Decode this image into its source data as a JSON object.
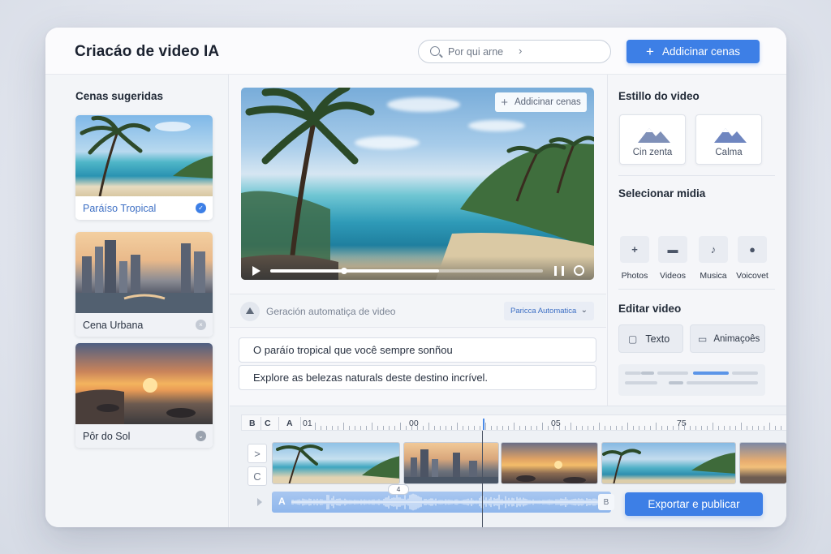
{
  "header": {
    "title": "Criacáo de video IA",
    "search_placeholder": "Por qui arne",
    "search_chevron": "›",
    "primary_button": "Addicinar cenas"
  },
  "sidebar": {
    "title": "Cenas sugeridas",
    "scenes": [
      {
        "label": "Paráíso Tropical",
        "selected": true,
        "status_icon": "check-circle-icon"
      },
      {
        "label": "Cena Urbana",
        "selected": false,
        "status_icon": "close-circle-icon"
      },
      {
        "label": "Pôr do Sol",
        "selected": false,
        "status_icon": "chevron-circle-icon"
      }
    ]
  },
  "preview": {
    "add_button": "Addicinar cenas",
    "progress": 0.62,
    "knob_position": 0.27
  },
  "autogen": {
    "label": "Geración automatiça de video",
    "dropdown": "Paricca Automatica",
    "chevron": "⌄"
  },
  "script_lines": [
    "O paráío tropical que você sempre sonñou",
    "Explore as belezas naturals deste destino incrível."
  ],
  "style_panel": {
    "title": "Estillo do video",
    "styles": [
      {
        "label": "Cin zenta"
      },
      {
        "label": "Calma"
      }
    ]
  },
  "media_panel": {
    "title": "Selecionar midia",
    "items": [
      {
        "label": "Photos",
        "icon": "photo-plus-icon",
        "glyph": "+"
      },
      {
        "label": "Videos",
        "icon": "video-icon",
        "glyph": "▬"
      },
      {
        "label": "Musica",
        "icon": "music-note-icon",
        "glyph": "♪"
      },
      {
        "label": "Voicovet",
        "icon": "microphone-icon",
        "glyph": "●"
      }
    ]
  },
  "edit_panel": {
    "title": "Editar video",
    "buttons": [
      {
        "label": "Texto",
        "glyph": "▢"
      },
      {
        "label": "Animaçoês",
        "glyph": "▭"
      }
    ]
  },
  "timeline": {
    "track_letters": [
      "B",
      "C",
      "A"
    ],
    "ruler_labels": [
      "01",
      "00",
      "05",
      "75"
    ],
    "side_buttons": [
      ">",
      "C"
    ],
    "audio_label": "A",
    "audio_end": "B",
    "audio_marker": "4",
    "export_button": "Exportar e publicar"
  },
  "colors": {
    "accent": "#3d7fe6",
    "selected_text": "#3d6fc4",
    "audio_track": "#8fb6ec"
  }
}
